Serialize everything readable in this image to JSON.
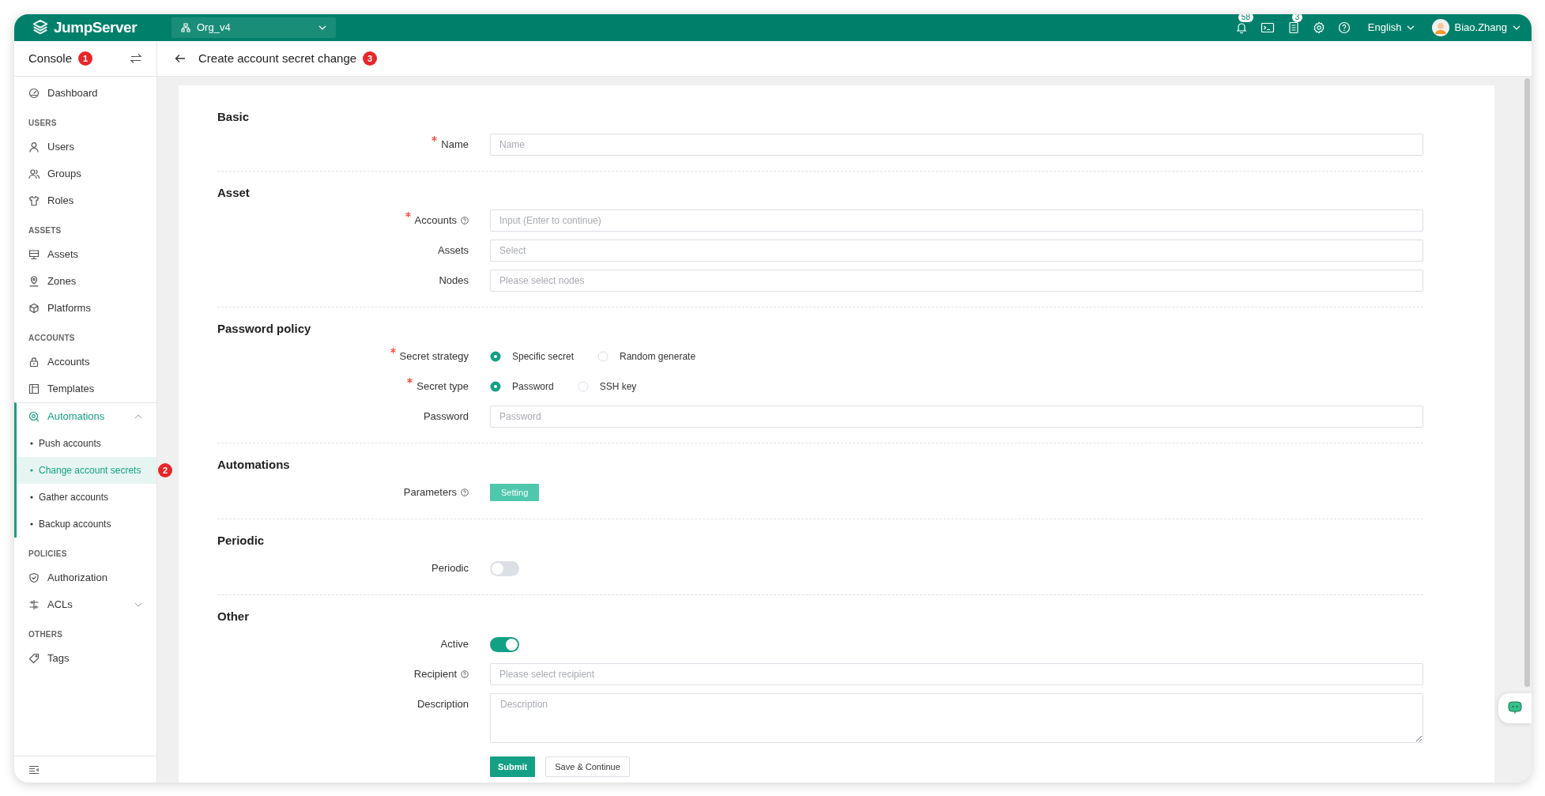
{
  "topbar": {
    "logo": "JumpServer",
    "org": "Org_v4",
    "notifications_badge": "58",
    "tasks_badge": "3",
    "language": "English",
    "user": "Biao.Zhang"
  },
  "sidebar": {
    "title": "Console",
    "badge": "1",
    "groups": [
      {
        "items": [
          {
            "label": "Dashboard",
            "selected": false
          }
        ]
      },
      {
        "heading": "USERS",
        "items": [
          {
            "label": "Users",
            "selected": false
          },
          {
            "label": "Groups",
            "selected": false
          },
          {
            "label": "Roles",
            "selected": false
          }
        ]
      },
      {
        "heading": "ASSETS",
        "items": [
          {
            "label": "Assets",
            "selected": false
          },
          {
            "label": "Zones",
            "selected": false
          },
          {
            "label": "Platforms",
            "selected": false
          }
        ]
      },
      {
        "heading": "ACCOUNTS",
        "items": [
          {
            "label": "Accounts",
            "selected": false
          },
          {
            "label": "Templates",
            "selected": false
          },
          {
            "label": "Automations",
            "selected": false,
            "expanded": true,
            "children": [
              {
                "label": "Push accounts",
                "selected": false
              },
              {
                "label": "Change account secrets",
                "selected": true,
                "badge": "2"
              },
              {
                "label": "Gather accounts",
                "selected": false
              },
              {
                "label": "Backup accounts",
                "selected": false
              }
            ]
          }
        ]
      },
      {
        "heading": "POLICIES",
        "items": [
          {
            "label": "Authorization",
            "selected": false
          },
          {
            "label": "ACLs",
            "selected": false,
            "expanded": false
          }
        ]
      },
      {
        "heading": "OTHERS",
        "items": [
          {
            "label": "Tags",
            "selected": false
          }
        ]
      }
    ]
  },
  "page_header": {
    "title": "Create account secret change",
    "badge": "3"
  },
  "form": {
    "sections": [
      {
        "title": "Basic",
        "fields": [
          {
            "kind": "input",
            "label": "Name",
            "required": true,
            "help": false,
            "placeholder": "Name"
          }
        ]
      },
      {
        "title": "Asset",
        "fields": [
          {
            "kind": "input",
            "label": "Accounts",
            "required": true,
            "help": true,
            "placeholder": "Input (Enter to continue)"
          },
          {
            "kind": "input",
            "label": "Assets",
            "required": false,
            "help": false,
            "placeholder": "Select"
          },
          {
            "kind": "input",
            "label": "Nodes",
            "required": false,
            "help": false,
            "placeholder": "Please select nodes"
          }
        ]
      },
      {
        "title": "Password policy",
        "fields": [
          {
            "kind": "radio",
            "label": "Secret strategy",
            "required": true,
            "help": false,
            "options": [
              {
                "label": "Specific secret",
                "selected": true
              },
              {
                "label": "Random generate",
                "selected": false
              }
            ]
          },
          {
            "kind": "radio",
            "label": "Secret type",
            "required": true,
            "help": false,
            "options": [
              {
                "label": "Password",
                "selected": true
              },
              {
                "label": "SSH key",
                "selected": false
              }
            ]
          },
          {
            "kind": "input",
            "label": "Password",
            "required": false,
            "help": false,
            "placeholder": "Password"
          }
        ]
      },
      {
        "title": "Automations",
        "fields": [
          {
            "kind": "button",
            "label": "Parameters",
            "required": false,
            "help": true,
            "button_label": "Setting"
          }
        ]
      },
      {
        "title": "Periodic",
        "fields": [
          {
            "kind": "switch",
            "label": "Periodic",
            "required": false,
            "help": false,
            "on": false
          }
        ]
      },
      {
        "title": "Other",
        "fields": [
          {
            "kind": "switch",
            "label": "Active",
            "required": false,
            "help": false,
            "on": true
          },
          {
            "kind": "input",
            "label": "Recipient",
            "required": false,
            "help": true,
            "placeholder": "Please select recipient"
          },
          {
            "kind": "textarea",
            "label": "Description",
            "required": false,
            "help": false,
            "placeholder": "Description"
          }
        ]
      }
    ],
    "actions": [
      {
        "label": "Submit",
        "kind": "primary"
      },
      {
        "label": "Save & Continue",
        "kind": "default"
      }
    ]
  }
}
